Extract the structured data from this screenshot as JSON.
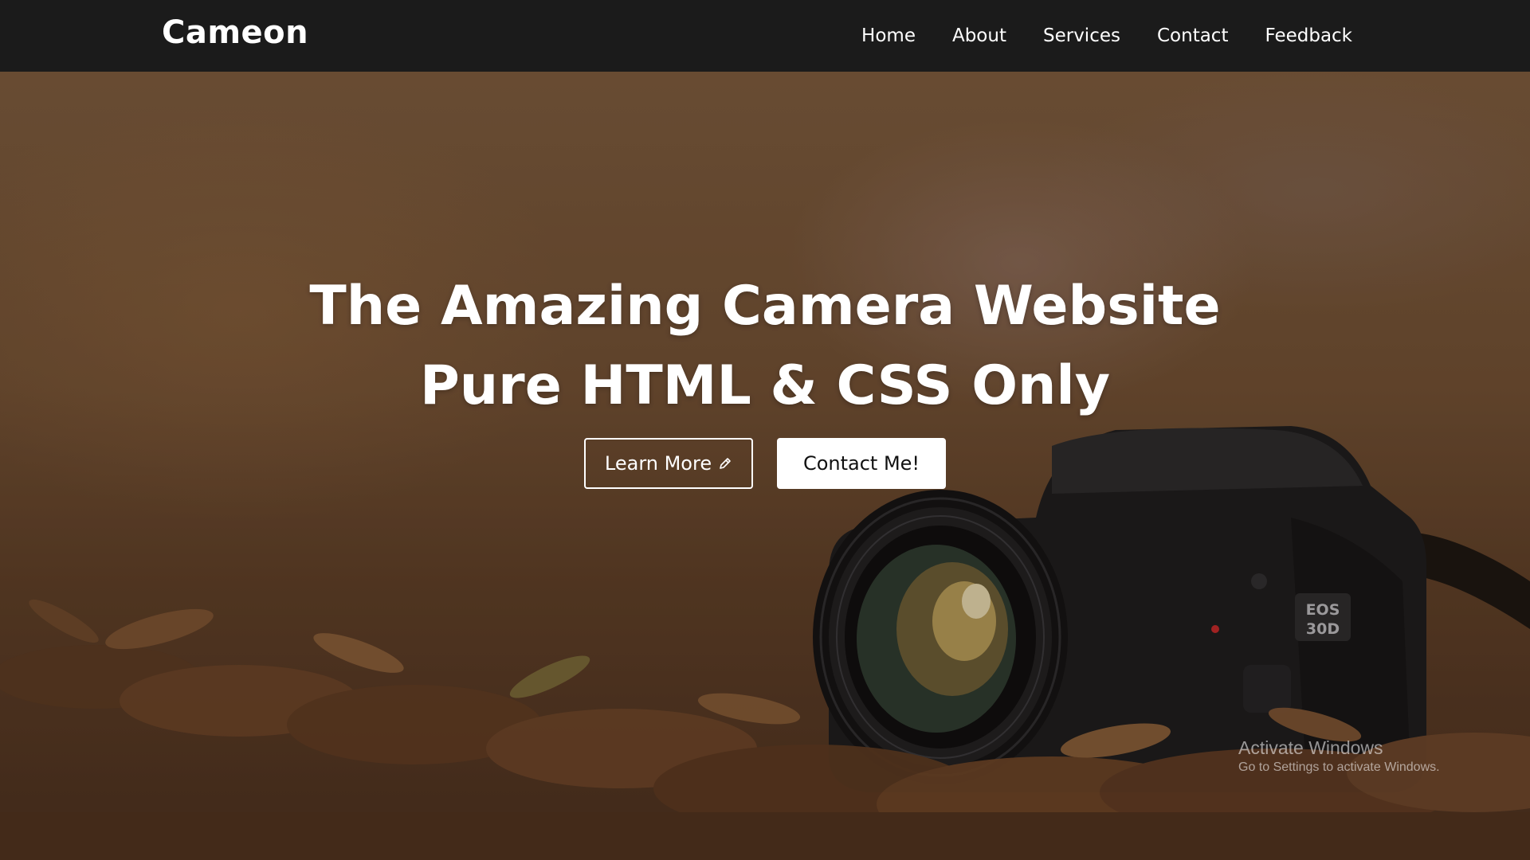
{
  "navbar": {
    "brand": "Cameon",
    "links": [
      "Home",
      "About",
      "Services",
      "Contact",
      "Feedback"
    ]
  },
  "hero": {
    "title_line1": "The Amazing Camera Website",
    "title_line2": "Pure HTML & CSS Only",
    "learn_more_label": "Learn More",
    "contact_label": "Contact Me!",
    "background_image": "camera-on-autumn-leaves",
    "camera_badge": "EOS 30D"
  },
  "watermark": {
    "title": "Activate Windows",
    "subtitle": "Go to Settings to activate Windows."
  },
  "colors": {
    "navbar_bg": "#1b1b1b",
    "text": "#ffffff",
    "button_solid_bg": "#ffffff",
    "button_solid_text": "#111111"
  },
  "icons": {
    "learn_more_icon": "pencil-icon"
  }
}
